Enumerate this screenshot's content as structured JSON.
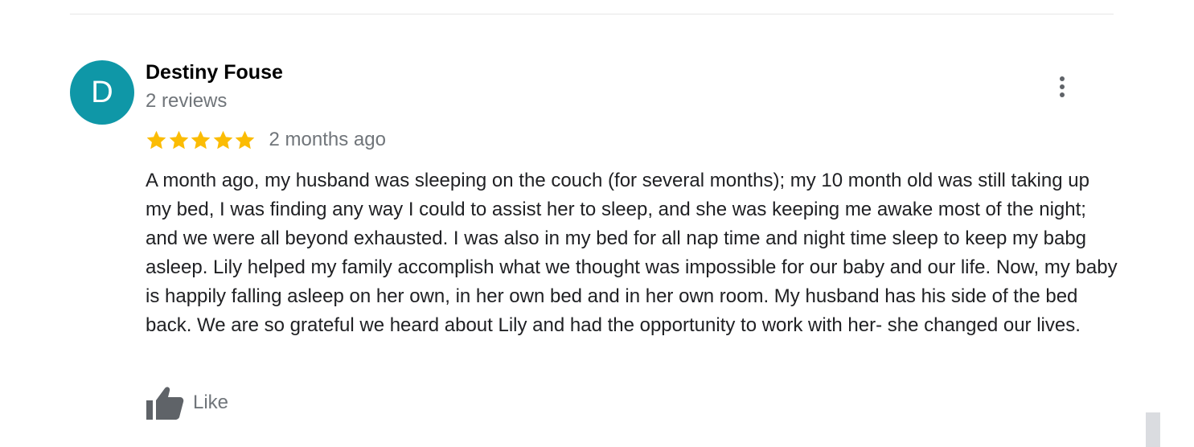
{
  "review": {
    "author": {
      "initial": "D",
      "name": "Destiny Fouse",
      "review_count": "2 reviews",
      "avatar_color": "#0f97a7"
    },
    "rating": 5,
    "rating_max": 5,
    "star_color": "#fbbc04",
    "time": "2 months ago",
    "text": "A month ago, my husband was sleeping on the couch (for several months); my 10 month old was still taking up my bed, I was finding any way I could to assist her to sleep, and she was keeping me awake most of the night; and we were all beyond exhausted. I was also in my bed for all nap time and night time sleep to keep my babg asleep. Lily helped my family accomplish what we thought was impossible for our baby and our life. Now, my baby is happily falling asleep on her own, in her own bed and in her own room. My husband has his side of the bed back. We are so grateful we heard about Lily and had the opportunity to work with her- she changed our lives.",
    "actions": {
      "like_label": "Like",
      "like_icon": "thumbs-up-icon",
      "more_icon": "more-vert-icon"
    }
  }
}
